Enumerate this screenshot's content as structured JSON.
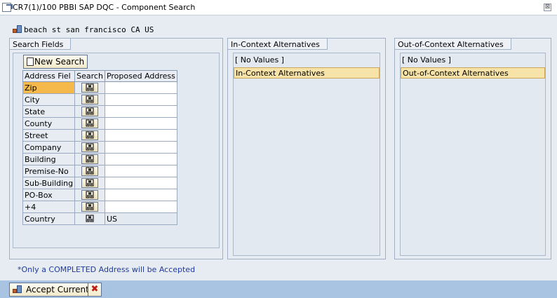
{
  "window": {
    "title": "CR7(1)/100 PBBI SAP DQC - Component Search",
    "close_glyph": "⊠"
  },
  "address": {
    "text": "beach st san francisco CA US",
    "icon": "address-book-icon"
  },
  "search_panel": {
    "tab_label": "Search Fields",
    "new_search_label": "New Search",
    "columns": [
      "Address Fiel",
      "Search",
      "Proposed Address"
    ],
    "rows": [
      {
        "field": "Zip",
        "proposed": "",
        "selected": true
      },
      {
        "field": "City",
        "proposed": ""
      },
      {
        "field": "State",
        "proposed": ""
      },
      {
        "field": "County",
        "proposed": ""
      },
      {
        "field": "Street",
        "proposed": ""
      },
      {
        "field": "Company",
        "proposed": ""
      },
      {
        "field": "Building",
        "proposed": ""
      },
      {
        "field": "Premise-No",
        "proposed": ""
      },
      {
        "field": "Sub-Building",
        "proposed": ""
      },
      {
        "field": "PO-Box",
        "proposed": ""
      },
      {
        "field": "+4",
        "proposed": ""
      },
      {
        "field": "Country",
        "proposed": "US",
        "readonly": true
      }
    ]
  },
  "in_context": {
    "tab_label": "In-Context Alternatives",
    "no_values": "[ No Values ]",
    "header": "In-Context Alternatives"
  },
  "out_context": {
    "tab_label": "Out-of-Context Alternatives",
    "no_values": "[ No Values ]",
    "header": "Out-of-Context Alternatives"
  },
  "note": "*Only a COMPLETED Address will be Accepted",
  "footer": {
    "accept_label": "Accept Current",
    "cancel_glyph": "✖"
  },
  "colors": {
    "selected_field": "#f4b94a",
    "highlight_row": "#f7e3a7",
    "note_text": "#1f3aa0",
    "footer_bg": "#a9c3e3"
  }
}
